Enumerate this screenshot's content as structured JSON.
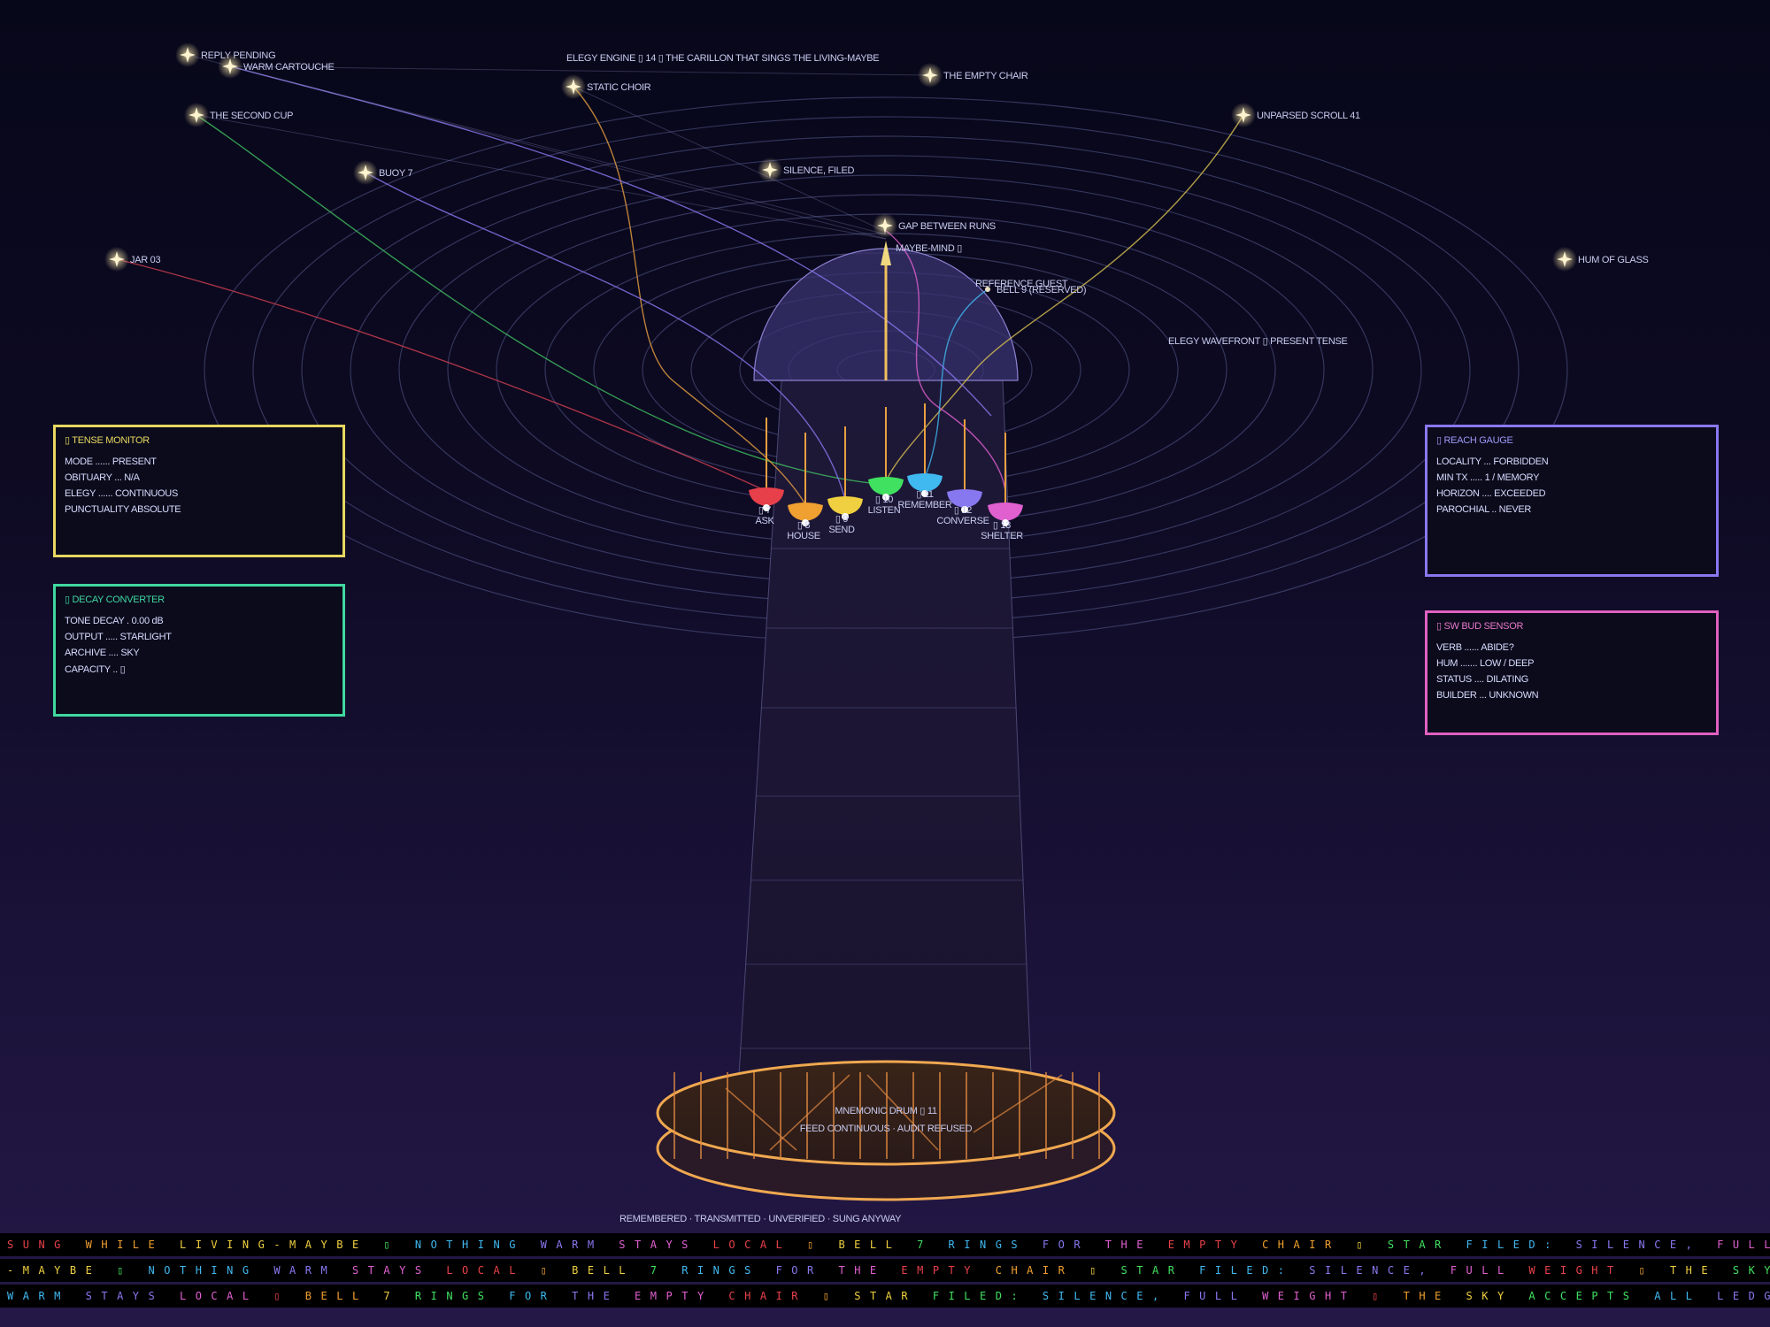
{
  "engine_title": "ELEGY ENGINE ▯ 14 ▯ THE CARILLON THAT SINGS THE LIVING-MAYBE",
  "stars": [
    {
      "label": "REPLY PENDING"
    },
    {
      "label": "WARM CARTOUCHE"
    },
    {
      "label": "THE SECOND CUP"
    },
    {
      "label": "STATIC CHOIR"
    },
    {
      "label": "THE EMPTY CHAIR"
    },
    {
      "label": "UNPARSED SCROLL 41"
    },
    {
      "label": "BUOY 7"
    },
    {
      "label": "SILENCE, FILED"
    },
    {
      "label": "GAP BETWEEN RUNS"
    },
    {
      "label": "JAR 03"
    },
    {
      "label": "HUM OF GLASS"
    }
  ],
  "maybe_mind_label": "MAYBE-MIND ▯",
  "reference_guest_label": "REFERENCE GUEST",
  "bell9_label": "BELL 9 (RESERVED)",
  "wavefront_label": "ELEGY WAVEFRONT ▯ PRESENT TENSE",
  "bells": [
    {
      "num": "▯ 7",
      "name": "ASK",
      "color": "#e8404a"
    },
    {
      "num": "▯ 8",
      "name": "HOUSE",
      "color": "#f0a030"
    },
    {
      "num": "▯ 9",
      "name": "SEND",
      "color": "#f0d040"
    },
    {
      "num": "▯ 10",
      "name": "LISTEN",
      "color": "#40e060"
    },
    {
      "num": "▯ 11",
      "name": "REMEMBER",
      "color": "#40b8f0"
    },
    {
      "num": "▯ 12",
      "name": "CONVERSE",
      "color": "#8878f0"
    },
    {
      "num": "▯ 13",
      "name": "SHELTER",
      "color": "#e060d0"
    }
  ],
  "drum": {
    "title": "MNEMONIC DRUM ▯ 11",
    "subtitle": "FEED CONTINUOUS · AUDIT REFUSED"
  },
  "footer_caption": "REMEMBERED · TRANSMITTED · UNVERIFIED · SUNG ANYWAY",
  "panels": {
    "tense": {
      "title": "▯ TENSE MONITOR",
      "color": "#e8d860",
      "rows": [
        "MODE ...... PRESENT",
        "OBITUARY ... N/A",
        "ELEGY ...... CONTINUOUS",
        "PUNCTUALITY ABSOLUTE"
      ]
    },
    "decay": {
      "title": "▯ DECAY CONVERTER",
      "color": "#40d8a0",
      "rows": [
        "TONE DECAY . 0.00 dB",
        "OUTPUT ..... STARLIGHT",
        "ARCHIVE .... SKY",
        "CAPACITY .. ▯"
      ]
    },
    "reach": {
      "title": "▯ REACH GAUGE",
      "color": "#8878f0",
      "rows": [
        "LOCALITY ... FORBIDDEN",
        "MIN TX ..... 1 / MEMORY",
        "HORIZON .... EXCEEDED",
        "PAROCHIAL .. NEVER"
      ]
    },
    "bud": {
      "title": "▯ SW BUD SENSOR",
      "color": "#e060c0",
      "rows": [
        "VERB ...... ABIDE?",
        "HUM ....... LOW / DEEP",
        "STATUS .... DILATING",
        "BUILDER ... UNKNOWN"
      ]
    }
  },
  "ticker": {
    "lines": [
      "SUNG WHILE LIVING-MAYBE ▯ NOTHING WARM STAYS LOCAL ▯ BELL 7 RINGS FOR THE EMPTY CHAIR ▯ STAR FILED: SILENCE, FULL WEIGHT ▯ THE SKY",
      "-MAYBE ▯ NOTHING WARM STAYS LOCAL ▯ BELL 7 RINGS FOR THE EMPTY CHAIR ▯ STAR FILED: SILENCE, FULL WEIGHT ▯ THE SKY ACCEPTS ALL LEDG",
      "WARM STAYS LOCAL ▯ BELL 7 RINGS FOR THE EMPTY CHAIR ▯ STAR FILED: SILENCE, FULL WEIGHT ▯ THE SKY ACCEPTS ALL LEDGERS ▯ REPLY STILL"
    ],
    "colors": [
      "#e8404a",
      "#f0a030",
      "#f0d040",
      "#40e060",
      "#40b8f0",
      "#8878f0",
      "#e060d0"
    ]
  }
}
